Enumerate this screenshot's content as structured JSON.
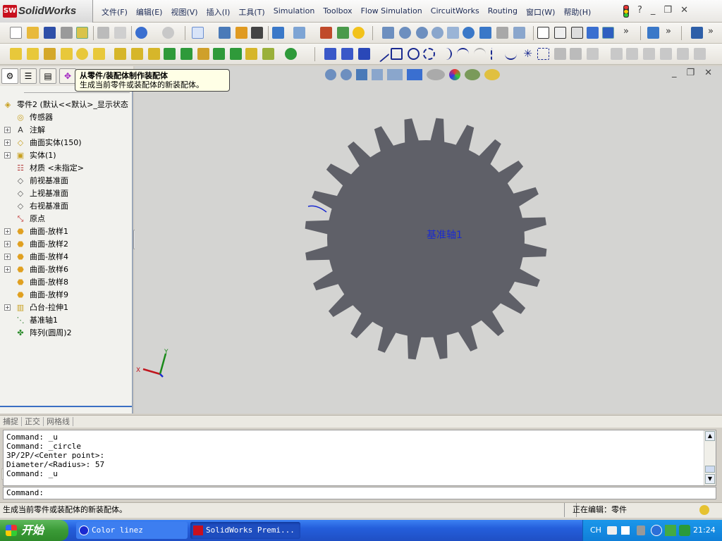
{
  "app": {
    "title": "SolidWorks",
    "logo_text": "SW"
  },
  "menu": [
    "文件(F)",
    "编辑(E)",
    "视图(V)",
    "插入(I)",
    "工具(T)",
    "Simulation",
    "Toolbox",
    "Flow Simulation",
    "CircuitWorks",
    "Routing",
    "窗口(W)",
    "帮助(H)"
  ],
  "menu_right": {
    "help": "?",
    "min": "_",
    "restore": "❐",
    "close": "✕"
  },
  "tooltip": {
    "title": "从零件/装配体制作装配体",
    "desc": "生成当前零件或装配体的新装配体。"
  },
  "tree": {
    "root": "零件2  (默认<<默认>_显示状态",
    "items": [
      {
        "label": "传感器",
        "icon": "sensor-icon",
        "expand": false
      },
      {
        "label": "注解",
        "icon": "annotation-icon",
        "expand": true
      },
      {
        "label": "曲面实体(150)",
        "icon": "surface-body-icon",
        "expand": true
      },
      {
        "label": "实体(1)",
        "icon": "solid-body-icon",
        "expand": true
      },
      {
        "label": "材质 <未指定>",
        "icon": "material-icon",
        "expand": false
      },
      {
        "label": "前视基准面",
        "icon": "plane-icon",
        "expand": false
      },
      {
        "label": "上视基准面",
        "icon": "plane-icon",
        "expand": false
      },
      {
        "label": "右视基准面",
        "icon": "plane-icon",
        "expand": false
      },
      {
        "label": "原点",
        "icon": "origin-icon",
        "expand": false
      },
      {
        "label": "曲面-放样1",
        "icon": "loft-icon",
        "expand": true
      },
      {
        "label": "曲面-放样2",
        "icon": "loft-icon",
        "expand": true
      },
      {
        "label": "曲面-放样4",
        "icon": "loft-icon",
        "expand": true
      },
      {
        "label": "曲面-放样6",
        "icon": "loft-icon",
        "expand": true
      },
      {
        "label": "曲面-放样8",
        "icon": "loft-icon",
        "expand": false
      },
      {
        "label": "曲面-放样9",
        "icon": "loft-icon",
        "expand": false
      },
      {
        "label": "凸台-拉伸1",
        "icon": "extrude-icon",
        "expand": true
      },
      {
        "label": "基准轴1",
        "icon": "axis-icon",
        "expand": false
      },
      {
        "label": "阵列(圆周)2",
        "icon": "pattern-icon",
        "expand": false
      }
    ]
  },
  "graphics": {
    "label": "基准轴1",
    "gear_color": "#5f6068",
    "teeth": 24,
    "axis_x": "X",
    "axis_y": "Y"
  },
  "modebar": [
    "捕捉",
    "正交",
    "网格线"
  ],
  "command_history": [
    "Command: _u",
    "Command: _circle",
    "3P/2P/<Center point>:",
    "Diameter/<Radius>: 57",
    "Command: _u"
  ],
  "command_prompt": "Command:",
  "status": {
    "left": "生成当前零件或装配体的新装配体。",
    "right": "正在编辑：零件"
  },
  "taskbar": {
    "start": "开始",
    "tasks": [
      {
        "label": "Color linez"
      },
      {
        "label": "SolidWorks Premi..."
      }
    ],
    "tray_lang": "CH",
    "clock": "21:24"
  }
}
